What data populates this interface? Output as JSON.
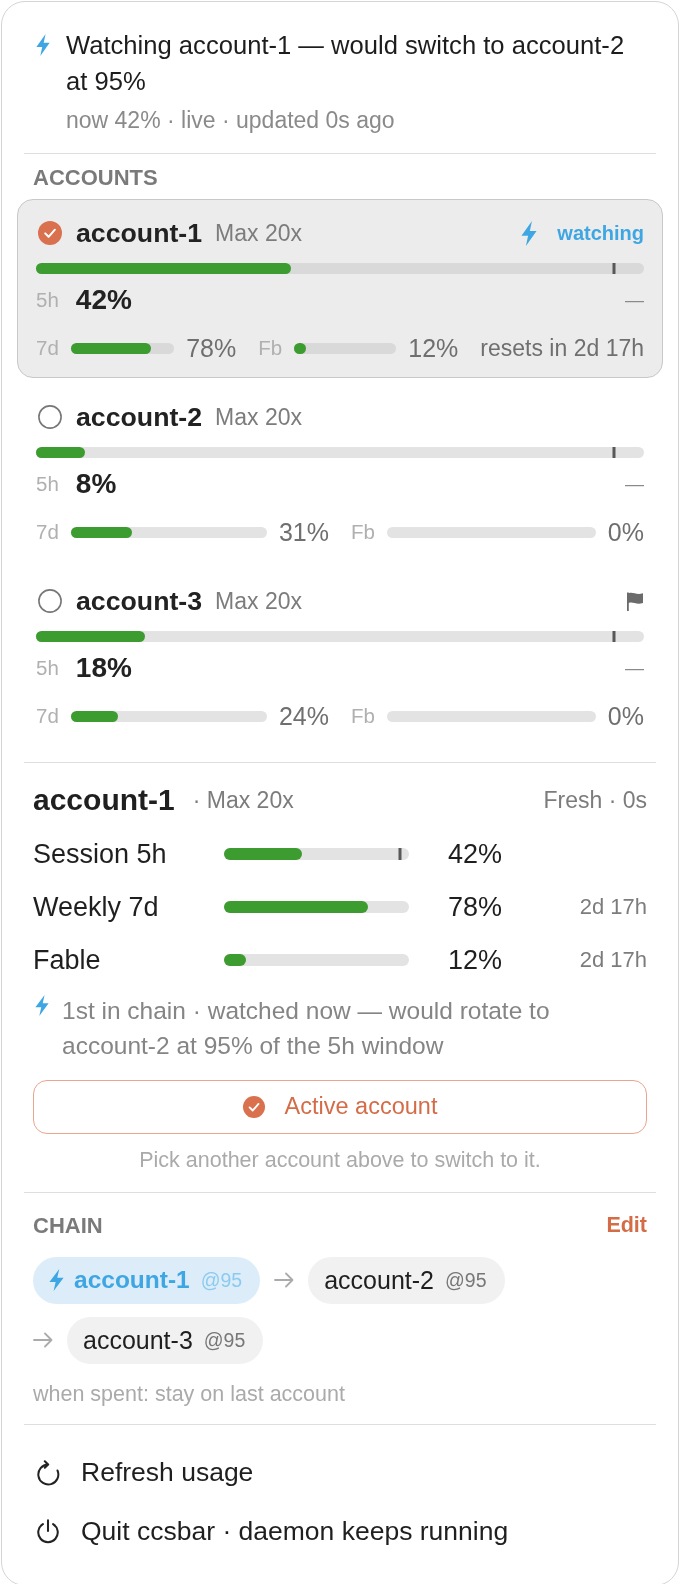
{
  "header": {
    "title": "Watching account-1 — would switch to account-2 at 95%",
    "status": "now 42% · live · updated 0s ago"
  },
  "accounts": {
    "heading": "ACCOUNTS",
    "items": [
      {
        "name": "account-1",
        "plan": "Max 20x",
        "selected": true,
        "watching": true,
        "watch_label": "watching",
        "flagged": false,
        "session": {
          "label": "5h",
          "value": "42%",
          "level": 0.42,
          "threshold": {
            "level": 0.95
          },
          "trend": "—"
        },
        "weekly": {
          "label": "7d",
          "value": "78%",
          "level": 0.78
        },
        "fable": {
          "label": "Fb",
          "value": "12%",
          "level": 0.12
        },
        "resets": "resets in 2d 17h"
      },
      {
        "name": "account-2",
        "plan": "Max 20x",
        "selected": false,
        "watching": false,
        "flagged": false,
        "session": {
          "label": "5h",
          "value": "8%",
          "level": 0.08,
          "threshold": {
            "level": 0.95
          },
          "trend": "—"
        },
        "weekly": {
          "label": "7d",
          "value": "31%",
          "level": 0.31
        },
        "fable": {
          "label": "Fb",
          "value": "0%",
          "level": 0
        }
      },
      {
        "name": "account-3",
        "plan": "Max 20x",
        "selected": false,
        "watching": false,
        "flagged": true,
        "session": {
          "label": "5h",
          "value": "18%",
          "level": 0.18,
          "threshold": {
            "level": 0.95
          },
          "trend": "—"
        },
        "weekly": {
          "label": "7d",
          "value": "24%",
          "level": 0.24
        },
        "fable": {
          "label": "Fb",
          "value": "0%",
          "level": 0
        }
      }
    ]
  },
  "detail": {
    "name": "account-1",
    "plan": "· Max 20x",
    "freshness": "Fresh · 0s",
    "meters": [
      {
        "label": "Session 5h",
        "value": "42%",
        "level": 0.42,
        "threshold": {
          "level": 0.95
        }
      },
      {
        "label": "Weekly 7d",
        "value": "78%",
        "level": 0.78,
        "reset": "2d 17h"
      },
      {
        "label": "Fable",
        "value": "12%",
        "level": 0.12,
        "reset": "2d 17h"
      }
    ],
    "note": "1st in chain · watched now — would rotate to account-2 at 95% of the 5h window",
    "button": {
      "label": "Active account"
    },
    "hint": "Pick another account above to switch to it."
  },
  "chain": {
    "heading": "CHAIN",
    "edit": "Edit",
    "items": [
      {
        "name": "account-1",
        "threshold": "@95",
        "active": true
      },
      {
        "name": "account-2",
        "threshold": "@95",
        "active": false
      },
      {
        "name": "account-3",
        "threshold": "@95",
        "active": false
      }
    ],
    "fallback": "when spent: stay on last account"
  },
  "menu": [
    {
      "kind": "refresh",
      "label": "Refresh usage"
    },
    {
      "kind": "quit",
      "label": "Quit ccsbar · daemon keeps running"
    }
  ]
}
